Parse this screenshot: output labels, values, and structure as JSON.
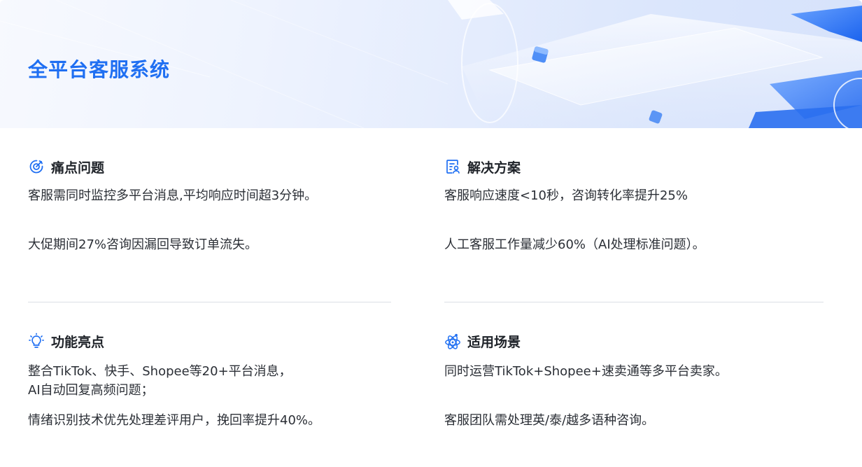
{
  "header": {
    "title": "全平台客服系统"
  },
  "sections": {
    "pain": {
      "title": "痛点问题",
      "icon": "target-icon",
      "lines": [
        "客服需同时监控多平台消息,平均响应时间超3分钟。",
        "大促期间27%咨询因漏回导致订单流失。"
      ]
    },
    "solution": {
      "title": "解决方案",
      "icon": "document-user-icon",
      "lines": [
        "客服响应速度<10秒，咨询转化率提升25%",
        "人工客服工作量减少60%（AI处理标准问题）。"
      ]
    },
    "features": {
      "title": "功能亮点",
      "icon": "lightbulb-icon",
      "lines": [
        "整合TikTok、快手、Shopee等20+平台消息，",
        "AI自动回复高频问题；",
        "情绪识别技术优先处理差评用户，挽回率提升40%。"
      ]
    },
    "scenarios": {
      "title": "适用场景",
      "icon": "atom-icon",
      "lines": [
        "同时运营TikTok+Shopee+速卖通等多平台卖家。",
        "客服团队需处理英/泰/越多语种咨询。"
      ]
    }
  },
  "colors": {
    "accent": "#1f6ff2",
    "text": "#2b2f36",
    "divider": "#dcdfe5"
  }
}
